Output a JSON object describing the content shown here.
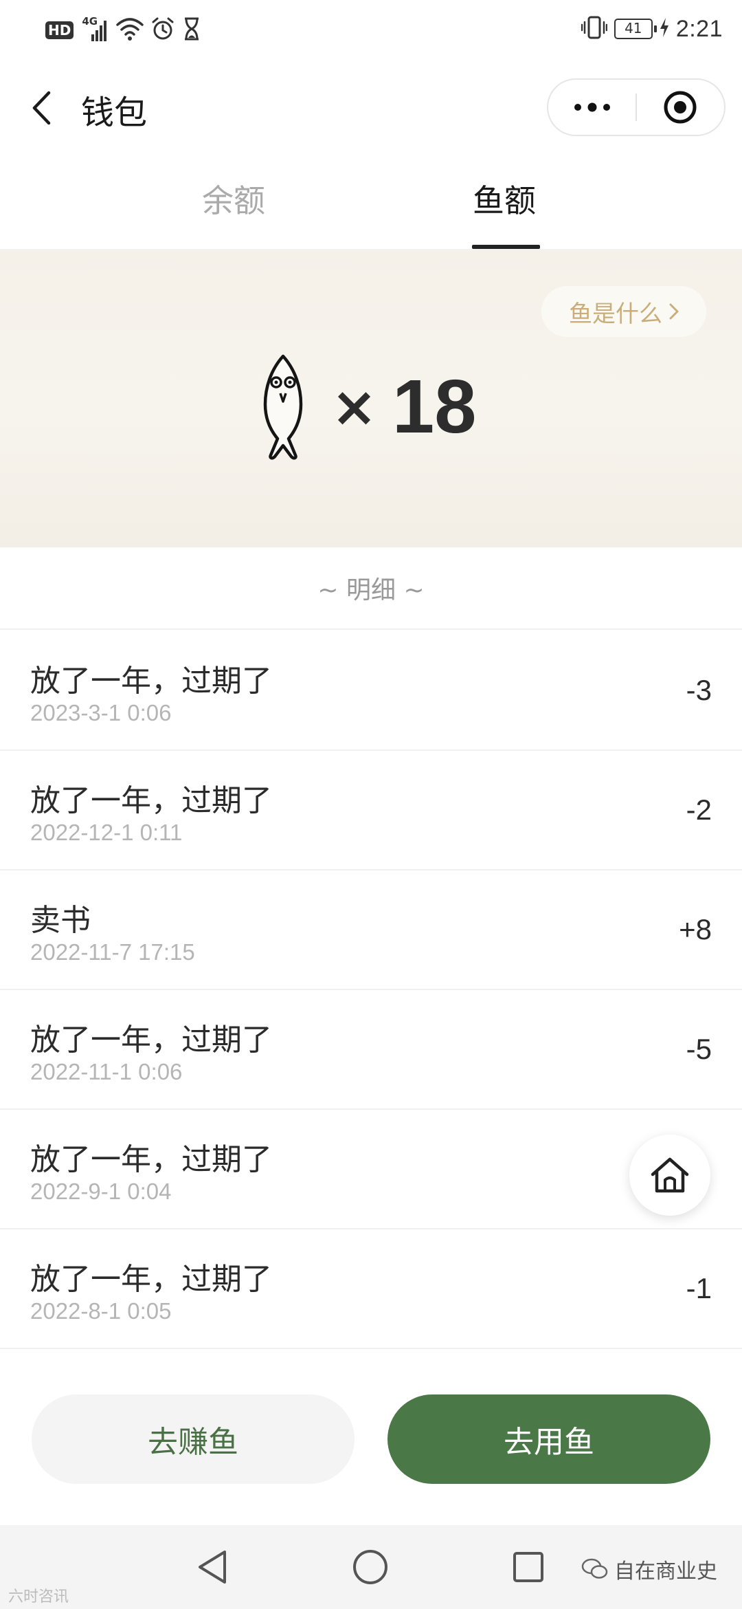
{
  "status_bar": {
    "hd": "HD",
    "network": "4G",
    "battery": "41",
    "time": "2:21"
  },
  "header": {
    "title": "钱包"
  },
  "tabs": [
    {
      "label": "余额",
      "active": false
    },
    {
      "label": "鱼额",
      "active": true
    }
  ],
  "banner": {
    "what_is_fish": "鱼是什么",
    "times_sign": "×",
    "count": "18"
  },
  "detail_heading": "~ 明细 ~",
  "records": [
    {
      "title": "放了一年，过期了",
      "time": "2023-3-1 0:06",
      "amount": "-3"
    },
    {
      "title": "放了一年，过期了",
      "time": "2022-12-1 0:11",
      "amount": "-2"
    },
    {
      "title": "卖书",
      "time": "2022-11-7 17:15",
      "amount": "+8"
    },
    {
      "title": "放了一年，过期了",
      "time": "2022-11-1 0:06",
      "amount": "-5"
    },
    {
      "title": "放了一年，过期了",
      "time": "2022-9-1 0:04",
      "amount": ""
    },
    {
      "title": "放了一年，过期了",
      "time": "2022-8-1 0:05",
      "amount": "-1"
    }
  ],
  "buttons": {
    "earn": "去赚鱼",
    "use": "去用鱼"
  },
  "watermarks": {
    "right": "自在商业史",
    "left": "六时咨讯"
  },
  "colors": {
    "accent_green": "#4a7847",
    "tag_gold": "#c9ae7c"
  }
}
